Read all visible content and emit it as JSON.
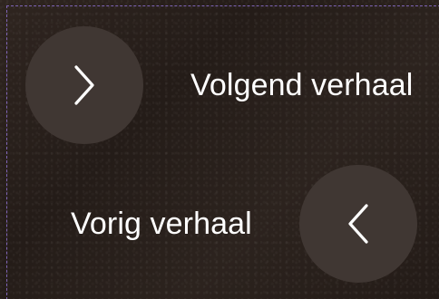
{
  "navigation": {
    "next": {
      "label": "Volgend verhaal",
      "icon": "chevron-right-icon"
    },
    "previous": {
      "label": "Vorig verhaal",
      "icon": "chevron-left-icon"
    }
  },
  "colors": {
    "background": "#2a211c",
    "button_circle": "#403733",
    "text": "#ffffff",
    "frame_border": "#7e64b6"
  }
}
